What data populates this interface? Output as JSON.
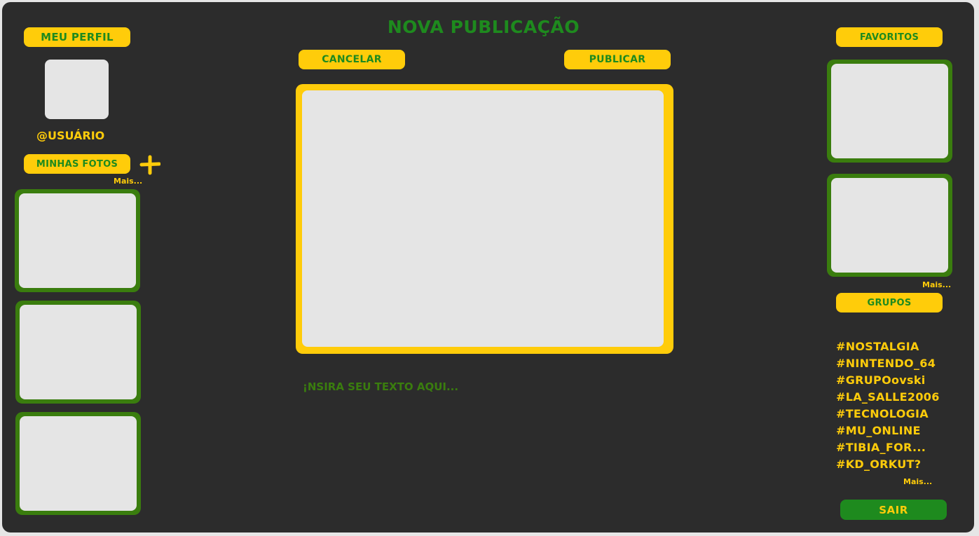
{
  "page": {
    "title": "NOVA PUBLICAÇÃO",
    "cancel_label": "CANCELAR",
    "publish_label": "PUBLICAR",
    "text_placeholder": "¡NSIRA SEU TEXTO AQUI..."
  },
  "left": {
    "profile_label": "MEU PERFIL",
    "username": "@USUÁRIO",
    "photos_label": "MINHAS FOTOS",
    "add_icon": "plus-icon",
    "more_label": "Mais..."
  },
  "right": {
    "favorites_label": "FAVORITOS",
    "favorites_more": "Mais...",
    "groups_label": "GRUPOS",
    "groups": [
      "#NOSTALGIA",
      "#NINTENDO_64",
      "#GRUPOovski",
      "#LA_SALLE2006",
      "#TECNOLOGIA",
      "#MU_ONLINE",
      "#TIBIA_FOR...",
      "#KD_ORKUT?"
    ],
    "groups_more": "Mais...",
    "logout_label": "SAIR"
  },
  "colors": {
    "background": "#2c2c2c",
    "accent_yellow": "#ffcc0a",
    "accent_green": "#1e8a1e",
    "thumb_border": "#3a7d0e",
    "placeholder": "#e5e5e5"
  }
}
